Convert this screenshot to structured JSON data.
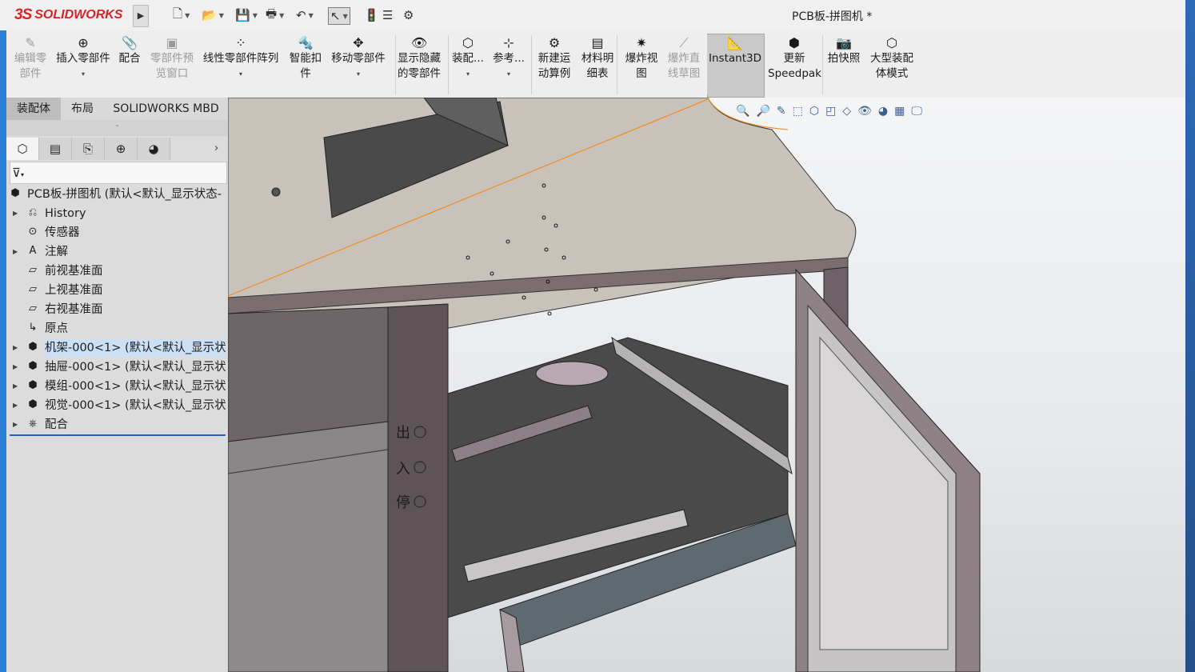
{
  "app": {
    "brand_symbol": "3S",
    "brand_name": "SOLIDWORKS",
    "document_title": "PCB板-拼图机 *"
  },
  "quick_access": {
    "items": [
      {
        "name": "new-icon",
        "glyph": "🗋"
      },
      {
        "name": "open-icon",
        "glyph": "📂"
      },
      {
        "name": "save-icon",
        "glyph": "💾"
      },
      {
        "name": "print-icon",
        "glyph": "🖶"
      },
      {
        "name": "undo-icon",
        "glyph": "↶"
      },
      {
        "name": "select-icon",
        "glyph": "↖"
      },
      {
        "name": "rebuild-icon",
        "glyph": "🚦"
      },
      {
        "name": "file-properties-icon",
        "glyph": "☰"
      },
      {
        "name": "options-icon",
        "glyph": "⚙"
      }
    ]
  },
  "command_manager": {
    "buttons": [
      {
        "line1": "编辑零",
        "line2": "部件",
        "icon": "✎",
        "disabled": true
      },
      {
        "line1": "插入零部件",
        "line2": "",
        "icon": "⊕",
        "disabled": false,
        "dropdown": true
      },
      {
        "line1": "配合",
        "line2": "",
        "icon": "📎",
        "disabled": false
      },
      {
        "line1": "零部件预",
        "line2": "览窗口",
        "icon": "▣",
        "disabled": true
      },
      {
        "line1": "线性零部件阵列",
        "line2": "",
        "icon": "⁘",
        "disabled": false,
        "dropdown": true
      },
      {
        "line1": "智能扣",
        "line2": "件",
        "icon": "🔩",
        "disabled": false
      },
      {
        "line1": "移动零部件",
        "line2": "",
        "icon": "✥",
        "disabled": false,
        "dropdown": true
      },
      {
        "line1": "显示隐藏",
        "line2": "的零部件",
        "icon": "👁",
        "disabled": false
      },
      {
        "line1": "装配...",
        "line2": "",
        "icon": "⬡",
        "disabled": false,
        "dropdown": true
      },
      {
        "line1": "参考...",
        "line2": "",
        "icon": "⊹",
        "disabled": false,
        "dropdown": true
      },
      {
        "line1": "新建运",
        "line2": "动算例",
        "icon": "⚙",
        "disabled": false
      },
      {
        "line1": "材料明",
        "line2": "细表",
        "icon": "▤",
        "disabled": false
      },
      {
        "line1": "爆炸视",
        "line2": "图",
        "icon": "✷",
        "disabled": false
      },
      {
        "line1": "爆炸直",
        "line2": "线草图",
        "icon": "⟋",
        "disabled": true
      },
      {
        "line1": "Instant3D",
        "line2": "",
        "icon": "📐",
        "disabled": false,
        "active": true
      },
      {
        "line1": "更新",
        "line2": "Speedpak",
        "icon": "⬢",
        "disabled": false
      },
      {
        "line1": "拍快照",
        "line2": "",
        "icon": "📷",
        "disabled": false
      },
      {
        "line1": "大型装配",
        "line2": "体模式",
        "icon": "⬡",
        "disabled": false
      }
    ]
  },
  "tabs": [
    "装配体",
    "布局",
    "SOLIDWORKS MBD"
  ],
  "panel_tabs": [
    {
      "name": "feature-manager-tab-icon",
      "glyph": "⬡"
    },
    {
      "name": "property-manager-tab-icon",
      "glyph": "▤"
    },
    {
      "name": "configuration-manager-tab-icon",
      "glyph": "⎘"
    },
    {
      "name": "dimxpert-tab-icon",
      "glyph": "⊕"
    },
    {
      "name": "display-manager-tab-icon",
      "glyph": "◕"
    }
  ],
  "filter": {
    "glyph": "⊽"
  },
  "tree": {
    "root": "PCB板-拼图机  (默认<默认_显示状态-",
    "items": [
      {
        "label": "History",
        "icon": "⎌",
        "expand": true
      },
      {
        "label": "传感器",
        "icon": "⊙",
        "expand": false
      },
      {
        "label": "注解",
        "icon": "A",
        "expand": true
      },
      {
        "label": "前视基准面",
        "icon": "▱",
        "expand": false
      },
      {
        "label": "上视基准面",
        "icon": "▱",
        "expand": false
      },
      {
        "label": "右视基准面",
        "icon": "▱",
        "expand": false
      },
      {
        "label": "原点",
        "icon": "↳",
        "expand": false
      },
      {
        "label": "机架-000<1> (默认<默认_显示状",
        "icon": "⬢",
        "expand": true,
        "selected": true
      },
      {
        "label": "抽屉-000<1> (默认<默认_显示状",
        "icon": "⬢",
        "expand": true
      },
      {
        "label": "模组-000<1> (默认<默认_显示状",
        "icon": "⬢",
        "expand": true
      },
      {
        "label": "视觉-000<1> (默认<默认_显示状",
        "icon": "⬢",
        "expand": true
      },
      {
        "label": "配合",
        "icon": "⎈",
        "expand": true
      }
    ]
  },
  "viewport": {
    "hud_tools": [
      "🔍",
      "🔎",
      "✎",
      "⬚",
      "⬡",
      "◰",
      "◇",
      "👁",
      "◕",
      "▦",
      "🖵"
    ],
    "panel_labels": [
      "出",
      "入",
      "停"
    ],
    "annotation_color": "#e01a1a"
  }
}
